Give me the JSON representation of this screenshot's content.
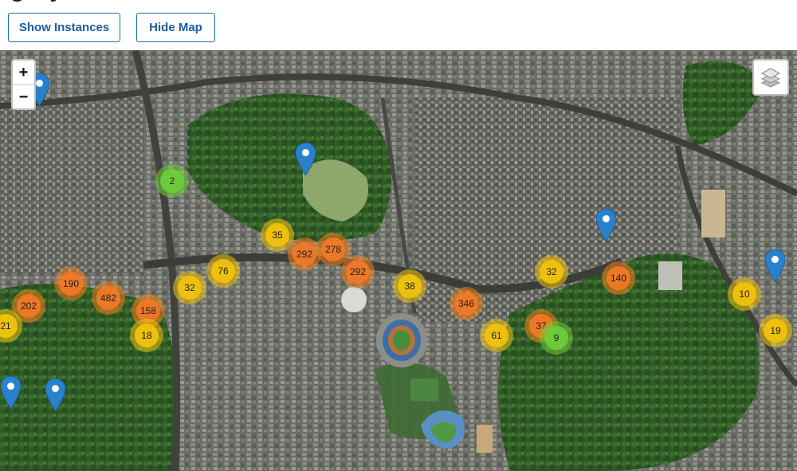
{
  "header": {
    "title_fragment": "rgary",
    "buttons": {
      "show_instances": "Show Instances",
      "hide_map": "Hide Map"
    }
  },
  "map": {
    "zoom_in_label": "+",
    "zoom_out_label": "−",
    "layers_icon": "layers-icon",
    "marker_icon": "map-pin-icon",
    "colors": {
      "orange": "#f07828",
      "yellow": "#f0c20c",
      "green": "#6ecc39",
      "marker": "#2a81cb"
    },
    "clusters": [
      {
        "count": "2",
        "color": "green"
      },
      {
        "count": "35",
        "color": "yellow"
      },
      {
        "count": "292",
        "color": "orange"
      },
      {
        "count": "278",
        "color": "orange"
      },
      {
        "count": "292",
        "color": "orange"
      },
      {
        "count": "76",
        "color": "yellow"
      },
      {
        "count": "32",
        "color": "yellow"
      },
      {
        "count": "190",
        "color": "orange"
      },
      {
        "count": "202",
        "color": "orange"
      },
      {
        "count": "482",
        "color": "orange"
      },
      {
        "count": "158",
        "color": "orange"
      },
      {
        "count": "18",
        "color": "yellow"
      },
      {
        "count": "21",
        "color": "yellow"
      },
      {
        "count": "38",
        "color": "yellow"
      },
      {
        "count": "346",
        "color": "orange"
      },
      {
        "count": "61",
        "color": "yellow"
      },
      {
        "count": "37",
        "color": "orange"
      },
      {
        "count": "9",
        "color": "green"
      },
      {
        "count": "32",
        "color": "yellow"
      },
      {
        "count": "140",
        "color": "orange"
      },
      {
        "count": "10",
        "color": "yellow"
      },
      {
        "count": "19",
        "color": "yellow"
      }
    ],
    "markers_count": 6
  }
}
